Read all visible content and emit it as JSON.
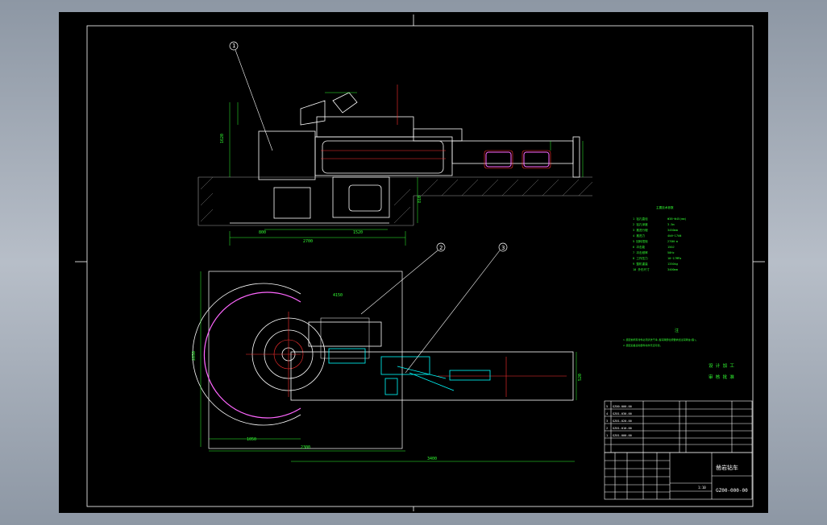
{
  "drawing": {
    "balloons": [
      "1",
      "2",
      "3"
    ],
    "dimensions": {
      "elev_overall": "2700",
      "elev_span_1": "1520",
      "elev_span_2": "800",
      "elev_height": "1620",
      "elev_lower": "810",
      "plan_height": "2850",
      "plan_width_1": "1050",
      "plan_width_2": "2300",
      "plan_overall": "3400",
      "plan_boom": "520",
      "plan_arc": "4150"
    },
    "tech_spec": {
      "heading": "主要技术参数",
      "rows": [
        {
          "k": "1 钻孔直径",
          "v": "Φ38~Φ45(mm)"
        },
        {
          "k": "2 钻孔深度",
          "v": "3.5m"
        },
        {
          "k": "3 推进行程",
          "v": "3450mm"
        },
        {
          "k": "4 推进力",
          "v": "4kN~17kN"
        },
        {
          "k": "5 回转扭矩",
          "v": "270N·m"
        },
        {
          "k": "6 冲击能",
          "v": "150J"
        },
        {
          "k": "7 冲击频率",
          "v": "50Hz"
        },
        {
          "k": "8 工作压力",
          "v": "10~17MPa"
        },
        {
          "k": "9 整机重量",
          "v": "1350kg"
        },
        {
          "k": "10 外形尺寸",
          "v": "3400mm"
        }
      ]
    },
    "notes": {
      "heading": "注",
      "lines": [
        "1.装配前所有零件必须清洗干净,各润滑部位按要求加注润滑油(脂)。",
        "2.装配后各运动部件动作灵活可靠。"
      ]
    },
    "signoff": {
      "line1": "设 计 加 工",
      "line2": "审 核 批 准"
    },
    "parts_list": [
      {
        "no": "5",
        "code": "GZ00-000-00"
      },
      {
        "no": "4",
        "code": "GZ01-030-00"
      },
      {
        "no": "3",
        "code": "GZ01-020-00"
      },
      {
        "no": "2",
        "code": "GZ01-010-00"
      },
      {
        "no": "1",
        "code": "GZ01-000-00"
      }
    ],
    "title_block": {
      "name": "凿岩钻车",
      "code": "GZ00-000-00",
      "scale": "1:10"
    }
  }
}
